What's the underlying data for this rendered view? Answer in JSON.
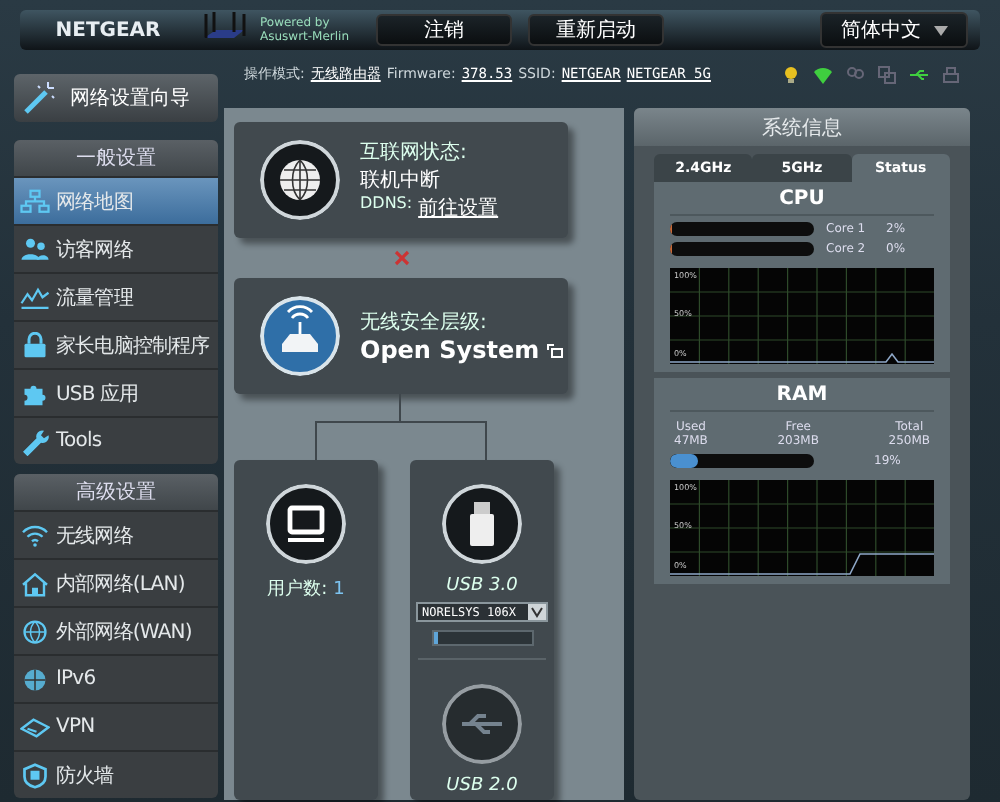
{
  "header": {
    "brand": "NETGEAR",
    "powered_by": [
      "Powered by",
      "Asuswrt-Merlin"
    ],
    "buttons": [
      "注销",
      "重新启动"
    ],
    "language": "简体中文"
  },
  "status_line": {
    "mode_label": "操作模式:",
    "mode": "无线路由器",
    "firmware_label": "Firmware:",
    "firmware": "378.53",
    "ssid_label": "SSID:",
    "ssids": [
      "NETGEAR",
      "NETGEAR_5G"
    ]
  },
  "sidebar": {
    "wizard": "网络设置向导",
    "groups": [
      {
        "title": "一般设置",
        "items": [
          {
            "label": "网络地图",
            "selected": true
          },
          {
            "label": "访客网络",
            "selected": false
          },
          {
            "label": "流量管理",
            "selected": false
          },
          {
            "label": "家长电脑控制程序",
            "selected": false
          },
          {
            "label": "USB 应用",
            "selected": false
          },
          {
            "label": "Tools",
            "selected": false
          }
        ]
      },
      {
        "title": "高级设置",
        "items": [
          {
            "label": "无线网络",
            "selected": false
          },
          {
            "label": "内部网络(LAN)",
            "selected": false
          },
          {
            "label": "外部网络(WAN)",
            "selected": false
          },
          {
            "label": "IPv6",
            "selected": false
          },
          {
            "label": "VPN",
            "selected": false
          },
          {
            "label": "防火墙",
            "selected": false
          }
        ]
      }
    ]
  },
  "network_map": {
    "internet": {
      "status_label": "互联网状态:",
      "status": "联机中断",
      "connected": false,
      "ddns_label": "DDNS:",
      "ddns_link": "前往设置"
    },
    "wireless": {
      "security_label": "无线安全层级:",
      "security": "Open System"
    },
    "clients": {
      "label": "用户数:",
      "count": "1"
    },
    "usb_ports": [
      {
        "name": "USB 3.0",
        "device": "NORELSYS 106X",
        "level": 0.06
      },
      {
        "name": "USB 2.0"
      }
    ]
  },
  "system_info": {
    "title": "系统信息",
    "tabs": [
      {
        "label": "2.4GHz",
        "selected": false
      },
      {
        "label": "5GHz",
        "selected": false
      },
      {
        "label": "Status",
        "selected": true
      }
    ],
    "cpu": {
      "title": "CPU",
      "cores": [
        {
          "name": "Core 1",
          "reading": "2%",
          "level": 0.02
        },
        {
          "name": "Core 2",
          "reading": "0%",
          "level": 0
        }
      ],
      "graph_ticks": [
        "100%",
        "50%",
        "0%"
      ]
    },
    "ram": {
      "title": "RAM",
      "stats": [
        {
          "label": "Used",
          "value": "47MB"
        },
        {
          "label": "Free",
          "value": "203MB"
        },
        {
          "label": "Total",
          "value": "250MB"
        }
      ],
      "level": 0.19,
      "reading": "19%",
      "graph_ticks": [
        "100%",
        "50%",
        "0%"
      ]
    }
  }
}
